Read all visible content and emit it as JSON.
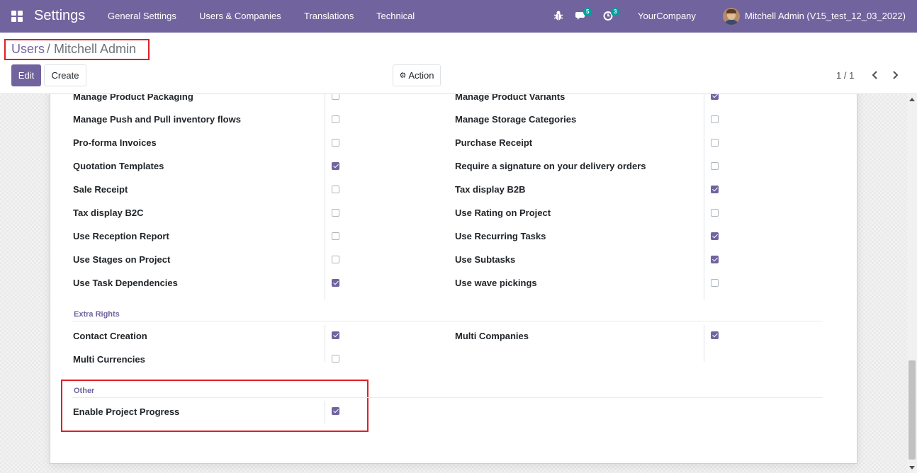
{
  "navbar": {
    "brand": "Settings",
    "menu": [
      "General Settings",
      "Users & Companies",
      "Translations",
      "Technical"
    ],
    "messages_badge": "5",
    "activities_badge": "3",
    "company": "YourCompany",
    "user": "Mitchell Admin (V15_test_12_03_2022)"
  },
  "breadcrumb": {
    "parent": "Users",
    "separator": "/",
    "current": "Mitchell Admin"
  },
  "toolbar": {
    "edit_label": "Edit",
    "create_label": "Create",
    "action_label": "Action",
    "pager": "1 / 1"
  },
  "settings": {
    "left": [
      {
        "label": "Manage Product Packaging",
        "checked": false
      },
      {
        "label": "Manage Push and Pull inventory flows",
        "checked": false
      },
      {
        "label": "Pro-forma Invoices",
        "checked": false
      },
      {
        "label": "Quotation Templates",
        "checked": true
      },
      {
        "label": "Sale Receipt",
        "checked": false
      },
      {
        "label": "Tax display B2C",
        "checked": false
      },
      {
        "label": "Use Reception Report",
        "checked": false
      },
      {
        "label": "Use Stages on Project",
        "checked": false
      },
      {
        "label": "Use Task Dependencies",
        "checked": true
      }
    ],
    "right": [
      {
        "label": "Manage Product Variants",
        "checked": true
      },
      {
        "label": "Manage Storage Categories",
        "checked": false
      },
      {
        "label": "Purchase Receipt",
        "checked": false
      },
      {
        "label": "Require a signature on your delivery orders",
        "checked": false
      },
      {
        "label": "Tax display B2B",
        "checked": true
      },
      {
        "label": "Use Rating on Project",
        "checked": false
      },
      {
        "label": "Use Recurring Tasks",
        "checked": true
      },
      {
        "label": "Use Subtasks",
        "checked": true
      },
      {
        "label": "Use wave pickings",
        "checked": false
      }
    ]
  },
  "extra_rights": {
    "title": "Extra Rights",
    "left": [
      {
        "label": "Contact Creation",
        "checked": true
      },
      {
        "label": "Multi Currencies",
        "checked": false
      }
    ],
    "right": [
      {
        "label": "Multi Companies",
        "checked": true
      }
    ]
  },
  "other": {
    "title": "Other",
    "left": [
      {
        "label": "Enable Project Progress",
        "checked": true
      }
    ]
  },
  "colors": {
    "primary": "#71639e",
    "highlight": "#e01f26",
    "badge": "#00a09d"
  }
}
